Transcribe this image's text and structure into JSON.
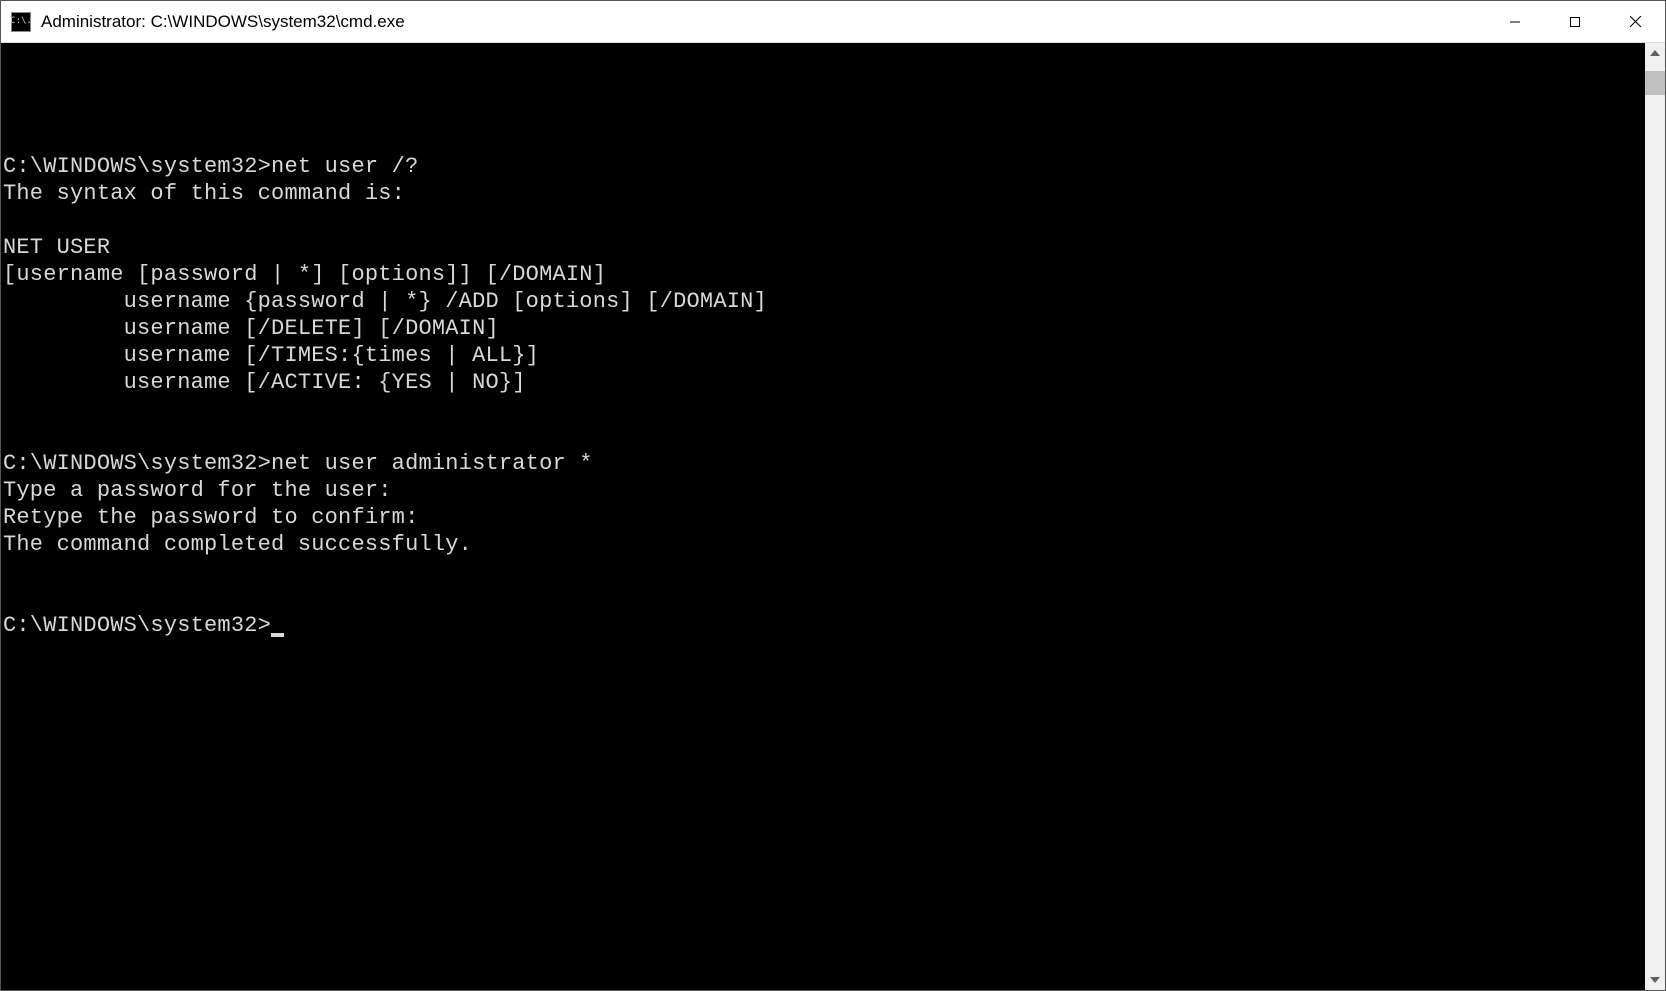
{
  "titlebar": {
    "title": "Administrator: C:\\WINDOWS\\system32\\cmd.exe",
    "icon_text": "C:\\."
  },
  "terminal": {
    "lines": [
      "C:\\WINDOWS\\system32>net user /?",
      "The syntax of this command is:",
      "",
      "NET USER",
      "[username [password | *] [options]] [/DOMAIN]",
      "         username {password | *} /ADD [options] [/DOMAIN]",
      "         username [/DELETE] [/DOMAIN]",
      "         username [/TIMES:{times | ALL}]",
      "         username [/ACTIVE: {YES | NO}]",
      "",
      "",
      "C:\\WINDOWS\\system32>net user administrator *",
      "Type a password for the user:",
      "Retype the password to confirm:",
      "The command completed successfully.",
      "",
      ""
    ],
    "current_prompt": "C:\\WINDOWS\\system32>"
  }
}
